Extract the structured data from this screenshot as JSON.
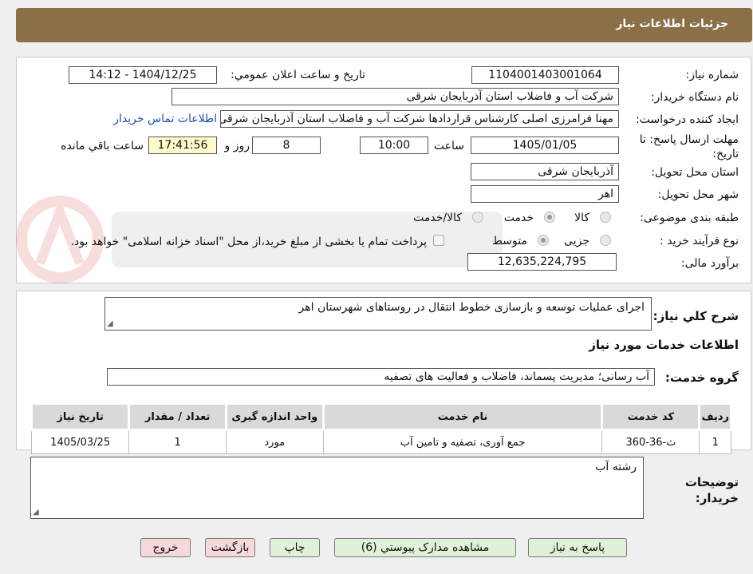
{
  "header": {
    "title": "جزئیات اطلاعات نیاز"
  },
  "form": {
    "need_number_label": "شماره نیاز:",
    "need_number": "1104001403001064",
    "announce_label": "تاریخ و ساعت اعلان عمومي:",
    "announce_value": "1404/12/25 - 14:12",
    "buyer_org_label": "نام دستگاه خریدار:",
    "buyer_org": "شرکت آب و فاضلاب استان آذربایجان شرقی",
    "creator_label": "ایجاد کننده درخواست:",
    "creator": "مهنا فرامرزی اصلی کارشناس قراردادها شرکت آب و فاضلاب استان آذربایجان شرقی",
    "contact_link": "اطلاعات تماس خریدار",
    "deadline_label": "مهلت ارسال پاسخ: تا تاریخ:",
    "deadline_date": "1405/01/05",
    "time_label": "ساعت",
    "deadline_time": "10:00",
    "days": "8",
    "days_label": "روز و",
    "remaining_time": "17:41:56",
    "remaining_label": "ساعت باقي مانده",
    "province_label": "استان محل تحویل:",
    "province": "آذربایجان شرقی",
    "city_label": "شهر محل تحویل:",
    "city": "اهر",
    "category_label": "طبقه بندی موضوعی:",
    "category_options": [
      "کالا",
      "خدمت",
      "کالا/خدمت"
    ],
    "process_label": "نوع فرآیند خرید :",
    "process_options": [
      "جزیی",
      "متوسط"
    ],
    "payment_note": "پرداخت تمام یا بخشی از مبلغ خرید،از محل \"اسناد خزانه اسلامی\" خواهد بود.",
    "budget_label": "برآورد مالی:",
    "budget": "12,635,224,795"
  },
  "description": {
    "label": "شرح کلي نیاز:",
    "text": "اجرای عملیات توسعه و بازسازی خطوط انتقال در روستاهای شهرستان اهر"
  },
  "services": {
    "section_title": "اطلاعات خدمات مورد نیاز",
    "group_label": "گروه خدمت:",
    "group_value": "آب رسانی؛ مدیریت پسماند، فاضلاب و فعالیت های تصفیه",
    "columns": [
      "ردیف",
      "کد خدمت",
      "نام خدمت",
      "واحد اندازه گیری",
      "تعداد / مقدار",
      "تاریخ نیاز"
    ],
    "rows": [
      [
        "1",
        "ث-36-360",
        "جمع آوری، تصفیه و تامین آب",
        "مورد",
        "1",
        "1405/03/25"
      ]
    ]
  },
  "buyer_notes": {
    "label": "توضیحات خریدار:",
    "text": "رشته آب"
  },
  "buttons": {
    "reply": "پاسخ به نیاز",
    "view_docs": "مشاهده مدارک پیوستي (6)",
    "print": "چاپ",
    "back": "بازگشت",
    "exit": "خروج"
  }
}
